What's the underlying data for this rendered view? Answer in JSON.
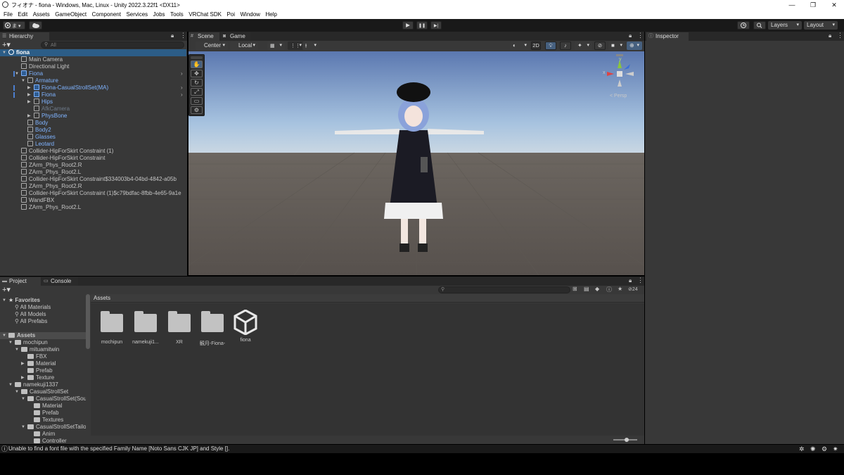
{
  "window": {
    "title": "フィオナ - fiona - Windows, Mac, Linux - Unity 2022.3.22f1 <DX11>",
    "minimize": "—",
    "maximize": "❐",
    "close": "✕"
  },
  "menu": [
    "File",
    "Edit",
    "Assets",
    "GameObject",
    "Component",
    "Services",
    "Jobs",
    "Tools",
    "VRChat SDK",
    "Poi",
    "Window",
    "Help"
  ],
  "toolbar": {
    "account_icon": "account-icon",
    "cloud_icon": "cloud-icon",
    "play_icon": "▶",
    "pause_icon": "❚❚",
    "step_icon": "▶|",
    "layers_label": "Layers",
    "layout_label": "Layout"
  },
  "hierarchy": {
    "tab_label": "Hierarchy",
    "search_placeholder": "All",
    "items": [
      {
        "label": "fiona",
        "indent": 0,
        "tri": "▼",
        "type": "scene",
        "color": "white",
        "selected": true
      },
      {
        "label": "Main Camera",
        "indent": 1,
        "tri": "",
        "type": "cube",
        "color": "normal"
      },
      {
        "label": "Directional Light",
        "indent": 1,
        "tri": "",
        "type": "cube",
        "color": "normal"
      },
      {
        "label": "Fiona",
        "indent": 1,
        "tri": "▼",
        "type": "prefab",
        "color": "blue",
        "arrow": true
      },
      {
        "label": "Armature",
        "indent": 2,
        "tri": "▼",
        "type": "cube",
        "color": "blue"
      },
      {
        "label": "Fiona-CasualStrollSet(MA)",
        "indent": 3,
        "tri": "▶",
        "type": "prefab",
        "color": "blue",
        "arrow": true
      },
      {
        "label": "Fiona",
        "indent": 3,
        "tri": "▶",
        "type": "prefab",
        "color": "blue",
        "arrow": true
      },
      {
        "label": "Hips",
        "indent": 3,
        "tri": "▶",
        "type": "cube",
        "color": "blue"
      },
      {
        "label": "AfkCamera",
        "indent": 3,
        "tri": "",
        "type": "cube",
        "color": "dim"
      },
      {
        "label": "PhysBone",
        "indent": 3,
        "tri": "▶",
        "type": "cube",
        "color": "blue"
      },
      {
        "label": "Body",
        "indent": 2,
        "tri": "",
        "type": "cube",
        "color": "blue"
      },
      {
        "label": "Body2",
        "indent": 2,
        "tri": "",
        "type": "cube",
        "color": "blue"
      },
      {
        "label": "Glasses",
        "indent": 2,
        "tri": "",
        "type": "cube",
        "color": "blue"
      },
      {
        "label": "Leotard",
        "indent": 2,
        "tri": "",
        "type": "cube",
        "color": "blue"
      },
      {
        "label": "Collider-HipForSkirt Constraint (1)",
        "indent": 1,
        "tri": "",
        "type": "cube",
        "color": "normal"
      },
      {
        "label": "Collider-HipForSkirt Constraint",
        "indent": 1,
        "tri": "",
        "type": "cube",
        "color": "normal"
      },
      {
        "label": "ZArm_Phys_Root2.R",
        "indent": 1,
        "tri": "",
        "type": "cube",
        "color": "normal"
      },
      {
        "label": "ZArm_Phys_Root2.L",
        "indent": 1,
        "tri": "",
        "type": "cube",
        "color": "normal"
      },
      {
        "label": "Collider-HipForSkirt Constraint$334003b4-04bd-4842-a05b",
        "indent": 1,
        "tri": "",
        "type": "cube",
        "color": "normal"
      },
      {
        "label": "ZArm_Phys_Root2.R",
        "indent": 1,
        "tri": "",
        "type": "cube",
        "color": "normal"
      },
      {
        "label": "Collider-HipForSkirt Constraint (1)$c79bdfac-8fbb-4e65-9a1e",
        "indent": 1,
        "tri": "",
        "type": "cube",
        "color": "normal"
      },
      {
        "label": "WandFBX",
        "indent": 1,
        "tri": "",
        "type": "cube",
        "color": "normal"
      },
      {
        "label": "ZArm_Phys_Root2.L",
        "indent": 1,
        "tri": "",
        "type": "cube",
        "color": "normal"
      }
    ]
  },
  "scene": {
    "tab_scene": "Scene",
    "tab_game": "Game",
    "pivot_label": "Center",
    "space_label": "Local",
    "mode_2d": "2D",
    "persp_label": "< Persp",
    "gizmo_x": "x",
    "gizmo_y": "y",
    "tools": [
      "✋",
      "✥",
      "↻",
      "⤢",
      "▭",
      "⚙"
    ]
  },
  "inspector": {
    "tab_label": "Inspector"
  },
  "project": {
    "tab_project": "Project",
    "tab_console": "Console",
    "hidden_count": "24",
    "breadcrumb": "Assets",
    "tree": [
      {
        "label": "Favorites",
        "indent": 0,
        "kind": "star",
        "tri": "▼",
        "bold": true
      },
      {
        "label": "All Materials",
        "indent": 1,
        "kind": "search",
        "tri": ""
      },
      {
        "label": "All Models",
        "indent": 1,
        "kind": "search",
        "tri": ""
      },
      {
        "label": "All Prefabs",
        "indent": 1,
        "kind": "search",
        "tri": ""
      },
      {
        "label": "",
        "indent": 0,
        "kind": "blank",
        "tri": ""
      },
      {
        "label": "Assets",
        "indent": 0,
        "kind": "folder",
        "tri": "▼",
        "bold": true,
        "selected": true
      },
      {
        "label": "mochipun",
        "indent": 1,
        "kind": "folder",
        "tri": "▼"
      },
      {
        "label": "mituamitwin",
        "indent": 2,
        "kind": "folder",
        "tri": "▼"
      },
      {
        "label": "FBX",
        "indent": 3,
        "kind": "folder",
        "tri": ""
      },
      {
        "label": "Material",
        "indent": 3,
        "kind": "folder",
        "tri": "▶"
      },
      {
        "label": "Prefab",
        "indent": 3,
        "kind": "folder",
        "tri": ""
      },
      {
        "label": "Texture",
        "indent": 3,
        "kind": "folder",
        "tri": "▶"
      },
      {
        "label": "namekuji1337",
        "indent": 1,
        "kind": "folder",
        "tri": "▼"
      },
      {
        "label": "CasualStrollSet",
        "indent": 2,
        "kind": "folder",
        "tri": "▼"
      },
      {
        "label": "CasualStrollSet(Sour",
        "indent": 3,
        "kind": "folder",
        "tri": "▼"
      },
      {
        "label": "Material",
        "indent": 4,
        "kind": "folder",
        "tri": ""
      },
      {
        "label": "Prefab",
        "indent": 4,
        "kind": "folder",
        "tri": ""
      },
      {
        "label": "Textures",
        "indent": 4,
        "kind": "folder",
        "tri": ""
      },
      {
        "label": "CasualStrollSetTailor",
        "indent": 3,
        "kind": "folder",
        "tri": "▼"
      },
      {
        "label": "Anim",
        "indent": 4,
        "kind": "folder",
        "tri": ""
      },
      {
        "label": "Controller",
        "indent": 4,
        "kind": "folder",
        "tri": ""
      }
    ],
    "assets": [
      {
        "label": "mochipun",
        "kind": "folder"
      },
      {
        "label": "namekuji1...",
        "kind": "folder"
      },
      {
        "label": "XR",
        "kind": "folder"
      },
      {
        "label": "観月-Fiona-",
        "kind": "folder"
      },
      {
        "label": "fiona",
        "kind": "unity"
      }
    ]
  },
  "status": {
    "message": "Unable to find a font file with the specified Family Name [Noto Sans CJK JP] and Style []."
  }
}
